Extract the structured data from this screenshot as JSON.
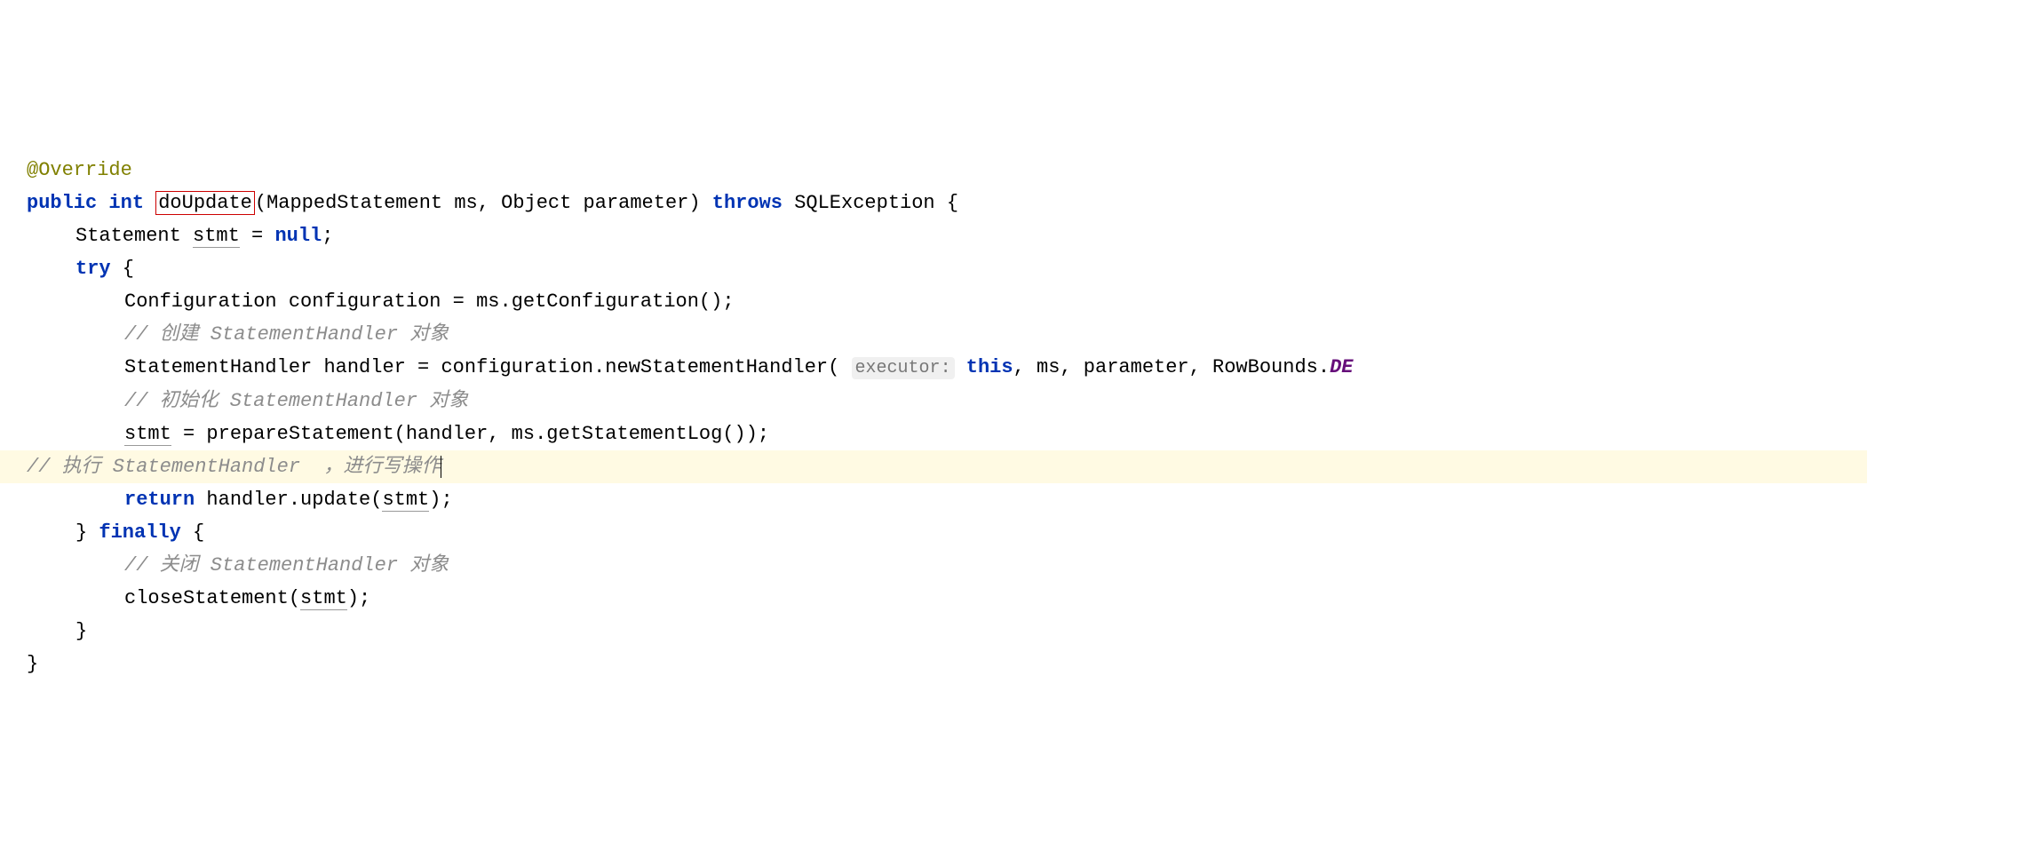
{
  "code": {
    "annotation": "@Override",
    "public": "public",
    "int": "int",
    "method_name": "doUpdate",
    "param1_type": "MappedStatement",
    "param1_name": "ms",
    "param2_type": "Object",
    "param2_name": "parameter",
    "throws": "throws",
    "exception": "SQLException",
    "decl_type": "Statement",
    "decl_var": "stmt",
    "equals": " = ",
    "null": "null",
    "try": "try",
    "conf_type": "Configuration",
    "conf_var": "configuration",
    "conf_expr": " = ms.getConfiguration();",
    "comment1": "// 创建 StatementHandler 对象",
    "handler_type": "StatementHandler",
    "handler_var": "handler",
    "handler_prefix": " = configuration.newStatementHandler(",
    "hint_executor": "executor:",
    "this": "this",
    "handler_args_rest": ", ms, parameter, RowBounds.",
    "rowbounds_field": "DE",
    "comment2": "// 初始化 StatementHandler 对象",
    "stmt_assign": " = prepareStatement(handler, ms.getStatementLog());",
    "comment3": "// 执行 StatementHandler  ，进行写操作",
    "return": "return",
    "return_expr_prefix": " handler.update(",
    "return_expr_suffix": ");",
    "finally": "finally",
    "comment4": "// 关闭 StatementHandler 对象",
    "close_prefix": "closeStatement(",
    "close_suffix": ");"
  }
}
